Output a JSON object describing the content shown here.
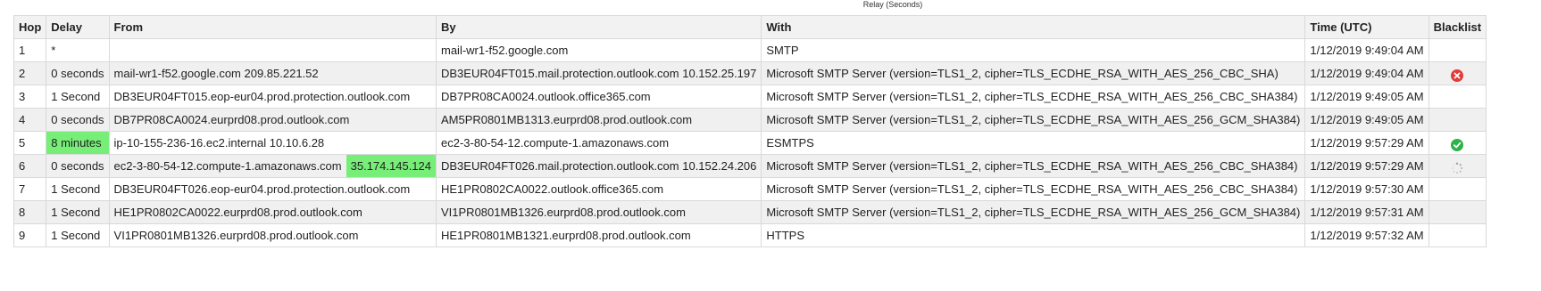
{
  "caption": "Relay (Seconds)",
  "columns": {
    "hop": "Hop",
    "delay": "Delay",
    "from": "From",
    "by": "By",
    "with": "With",
    "time": "Time (UTC)",
    "blacklist": "Blacklist"
  },
  "rows": [
    {
      "hop": "1",
      "delay": "*",
      "from": "",
      "by": "mail-wr1-f52.google.com",
      "with": "SMTP",
      "time": "1/12/2019 9:49:04 AM",
      "blacklist": ""
    },
    {
      "hop": "2",
      "delay": "0 seconds",
      "from": "mail-wr1-f52.google.com 209.85.221.52",
      "by": "DB3EUR04FT015.mail.protection.outlook.com 10.152.25.197",
      "with": "Microsoft SMTP Server (version=TLS1_2, cipher=TLS_ECDHE_RSA_WITH_AES_256_CBC_SHA)",
      "time": "1/12/2019 9:49:04 AM",
      "blacklist": "red-x-icon"
    },
    {
      "hop": "3",
      "delay": "1 Second",
      "from": "DB3EUR04FT015.eop-eur04.prod.protection.outlook.com",
      "by": "DB7PR08CA0024.outlook.office365.com",
      "with": "Microsoft SMTP Server (version=TLS1_2, cipher=TLS_ECDHE_RSA_WITH_AES_256_CBC_SHA384)",
      "time": "1/12/2019 9:49:05 AM",
      "blacklist": ""
    },
    {
      "hop": "4",
      "delay": "0 seconds",
      "from": "DB7PR08CA0024.eurprd08.prod.outlook.com",
      "by": "AM5PR0801MB1313.eurprd08.prod.outlook.com",
      "with": "Microsoft SMTP Server (version=TLS1_2, cipher=TLS_ECDHE_RSA_WITH_AES_256_GCM_SHA384)",
      "time": "1/12/2019 9:49:05 AM",
      "blacklist": ""
    },
    {
      "hop": "5",
      "delay": "8 minutes",
      "from": "ip-10-155-236-16.ec2.internal 10.10.6.28",
      "by": "ec2-3-80-54-12.compute-1.amazonaws.com",
      "with": "ESMTPS",
      "time": "1/12/2019 9:57:29 AM",
      "blacklist": "green-check-icon"
    },
    {
      "hop": "6",
      "delay": "0 seconds",
      "from_host": "ec2-3-80-54-12.compute-1.amazonaws.com",
      "from_ip": "35.174.145.124",
      "by": "DB3EUR04FT026.mail.protection.outlook.com 10.152.24.206",
      "with": "Microsoft SMTP Server (version=TLS1_2, cipher=TLS_ECDHE_RSA_WITH_AES_256_CBC_SHA384)",
      "time": "1/12/2019 9:57:29 AM",
      "blacklist": "loading-spinner-icon"
    },
    {
      "hop": "7",
      "delay": "1 Second",
      "from": "DB3EUR04FT026.eop-eur04.prod.protection.outlook.com",
      "by": "HE1PR0802CA0022.outlook.office365.com",
      "with": "Microsoft SMTP Server (version=TLS1_2, cipher=TLS_ECDHE_RSA_WITH_AES_256_CBC_SHA384)",
      "time": "1/12/2019 9:57:30 AM",
      "blacklist": ""
    },
    {
      "hop": "8",
      "delay": "1 Second",
      "from": "HE1PR0802CA0022.eurprd08.prod.outlook.com",
      "by": "VI1PR0801MB1326.eurprd08.prod.outlook.com",
      "with": "Microsoft SMTP Server (version=TLS1_2, cipher=TLS_ECDHE_RSA_WITH_AES_256_GCM_SHA384)",
      "time": "1/12/2019 9:57:31 AM",
      "blacklist": ""
    },
    {
      "hop": "9",
      "delay": "1 Second",
      "from": "VI1PR0801MB1326.eurprd08.prod.outlook.com",
      "by": "HE1PR0801MB1321.eurprd08.prod.outlook.com",
      "with": "HTTPS",
      "time": "1/12/2019 9:57:32 AM",
      "blacklist": ""
    }
  ],
  "colors": {
    "highlight": "#77ee77",
    "blacklist_bad": "#e03c3c",
    "blacklist_good": "#2db34a",
    "header_bg": "#f2f2f2",
    "border": "#d9d9d9"
  }
}
